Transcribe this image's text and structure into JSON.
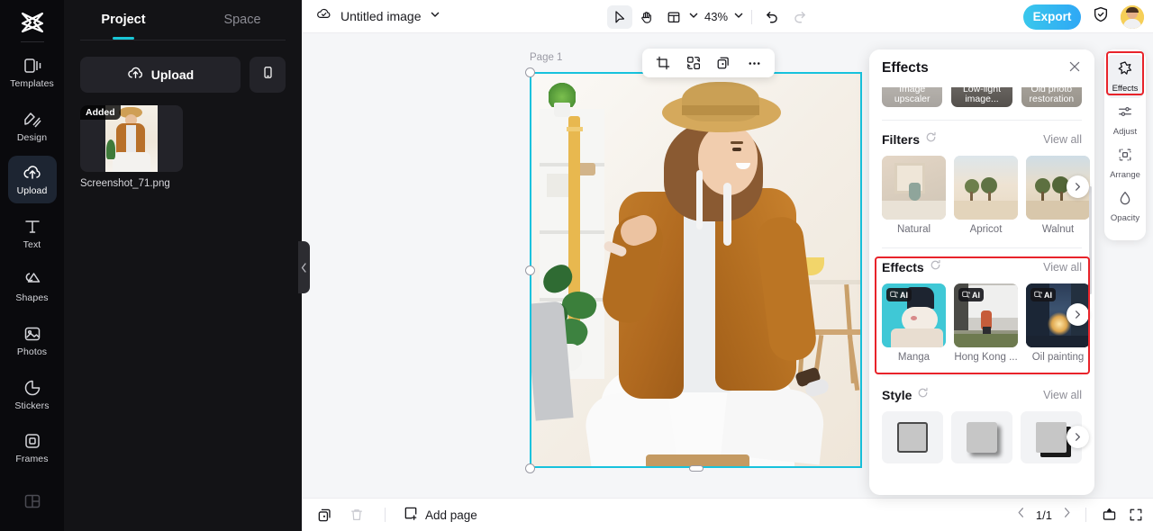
{
  "app": {
    "logo_icon": "capcut-logo-icon"
  },
  "rail": {
    "items": [
      {
        "label": "Templates",
        "icon": "templates-icon",
        "active": false
      },
      {
        "label": "Design",
        "icon": "design-icon",
        "active": false
      },
      {
        "label": "Upload",
        "icon": "upload-cloud-icon",
        "active": true
      },
      {
        "label": "Text",
        "icon": "text-icon",
        "active": false
      },
      {
        "label": "Shapes",
        "icon": "shapes-icon",
        "active": false
      },
      {
        "label": "Photos",
        "icon": "photos-icon",
        "active": false
      },
      {
        "label": "Stickers",
        "icon": "stickers-icon",
        "active": false
      },
      {
        "label": "Frames",
        "icon": "frames-icon",
        "active": false
      },
      {
        "label": "",
        "icon": "layout-grid-icon",
        "active": false
      }
    ]
  },
  "panel": {
    "tabs": [
      {
        "label": "Project",
        "active": true
      },
      {
        "label": "Space",
        "active": false
      }
    ],
    "upload_label": "Upload",
    "upload_icon": "upload-cloud-icon",
    "phone_icon": "mobile-upload-icon",
    "assets": [
      {
        "name": "Screenshot_71.png",
        "badge": "Added"
      }
    ]
  },
  "topbar": {
    "cloud_icon": "cloud-saved-icon",
    "doc_title": "Untitled image",
    "title_chevron_icon": "chevron-down-icon",
    "tools": [
      {
        "icon": "cursor-select-icon",
        "name": "select-tool",
        "selected": true
      },
      {
        "icon": "hand-pan-icon",
        "name": "hand-tool",
        "selected": false
      },
      {
        "icon": "layout-panel-icon",
        "name": "layout-tool",
        "selected": false
      }
    ],
    "layout_chevron_icon": "chevron-down-icon",
    "zoom_level": "43%",
    "zoom_chevron_icon": "chevron-down-icon",
    "undo_icon": "undo-icon",
    "redo_icon": "redo-icon",
    "export_label": "Export",
    "shield_icon": "shield-check-icon",
    "avatar_icon": "user-avatar"
  },
  "canvas": {
    "page_label": "Page 1",
    "float_toolbar": [
      {
        "icon": "crop-icon",
        "name": "crop-button"
      },
      {
        "icon": "remove-background-icon",
        "name": "remove-background-button"
      },
      {
        "icon": "duplicate-icon",
        "name": "duplicate-button"
      },
      {
        "icon": "more-options-icon",
        "name": "more-options-button"
      }
    ],
    "selection_color": "#17c2dd"
  },
  "bottombar": {
    "duplicate_page_icon": "duplicate-page-icon",
    "delete_page_icon": "trash-icon",
    "add_page_icon": "add-page-icon",
    "add_page_label": "Add page",
    "prev_icon": "chevron-left-icon",
    "next_icon": "chevron-right-icon",
    "page_indicator": "1/1",
    "present_icon": "present-icon",
    "fullscreen_icon": "fullscreen-icon"
  },
  "effects_panel": {
    "title": "Effects",
    "close_icon": "close-icon",
    "ai_tools": [
      {
        "label": "Image upscaler"
      },
      {
        "label": "Low-light image..."
      },
      {
        "label": "Old photo restoration"
      }
    ],
    "sections": [
      {
        "title": "Filters",
        "refresh_icon": "refresh-icon",
        "view_all": "View all",
        "items": [
          {
            "label": "Natural",
            "ai": false
          },
          {
            "label": "Apricot",
            "ai": false
          },
          {
            "label": "Walnut",
            "ai": false
          }
        ],
        "next_icon": "chevron-right-icon",
        "highlighted": false
      },
      {
        "title": "Effects",
        "refresh_icon": "refresh-icon",
        "view_all": "View all",
        "items": [
          {
            "label": "Manga",
            "ai": true,
            "ai_tag": "AI"
          },
          {
            "label": "Hong Kong ...",
            "ai": true,
            "ai_tag": "AI"
          },
          {
            "label": "Oil painting",
            "ai": true,
            "ai_tag": "AI"
          }
        ],
        "next_icon": "chevron-right-icon",
        "highlighted": true
      },
      {
        "title": "Style",
        "refresh_icon": "refresh-icon",
        "view_all": "View all",
        "items": [
          {
            "label": "",
            "ai": false
          },
          {
            "label": "",
            "ai": false
          },
          {
            "label": "",
            "ai": false
          }
        ],
        "next_icon": "chevron-right-icon",
        "highlighted": false
      }
    ]
  },
  "dock": {
    "items": [
      {
        "label": "Effects",
        "icon": "effects-star-icon",
        "active": true
      },
      {
        "label": "Adjust",
        "icon": "adjust-sliders-icon",
        "active": false
      },
      {
        "label": "Arrange",
        "icon": "arrange-icon",
        "active": false
      },
      {
        "label": "Opacity",
        "icon": "opacity-drop-icon",
        "active": false
      }
    ]
  },
  "colors": {
    "accent_cyan": "#19c6d6",
    "highlight_red": "#e8232a",
    "export_blue": "#2fa8f5",
    "dark_rail": "#0a0a0d",
    "dark_panel": "#131316"
  }
}
